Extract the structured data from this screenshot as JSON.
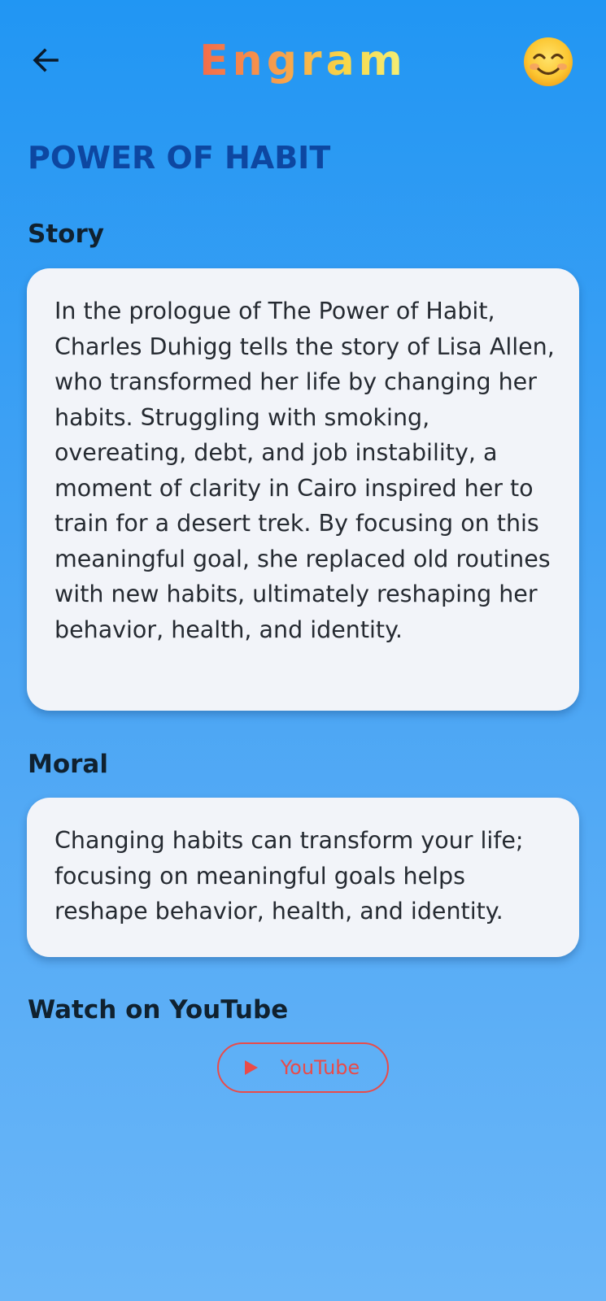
{
  "app_bar": {
    "title": "Engram",
    "back_icon": "arrow-left-icon",
    "emoji_icon": "smiling-face-icon"
  },
  "page": {
    "title": "POWER OF HABIT"
  },
  "story": {
    "heading": "Story",
    "text": "In the prologue of The Power of Habit, Charles Duhigg tells the story of Lisa Allen, who transformed her life by changing her habits. Struggling with smoking, overeating, debt, and job instability, a moment of clarity in Cairo inspired her to train for a desert trek. By focusing on this meaningful goal, she replaced old routines with new habits, ultimately reshaping her behavior, health, and identity."
  },
  "moral": {
    "heading": "Moral",
    "text": "Changing habits can transform your life; focusing on meaningful goals helps reshape behavior, health, and identity."
  },
  "youtube": {
    "heading": "Watch on YouTube",
    "button_label": "YouTube",
    "icon": "play-icon"
  },
  "colors": {
    "background_top": "#2196f3",
    "background_bottom": "#6ab6f8",
    "page_title": "#0d47a1",
    "card_background": "#f2f4f9",
    "youtube_red": "#e94b49"
  }
}
